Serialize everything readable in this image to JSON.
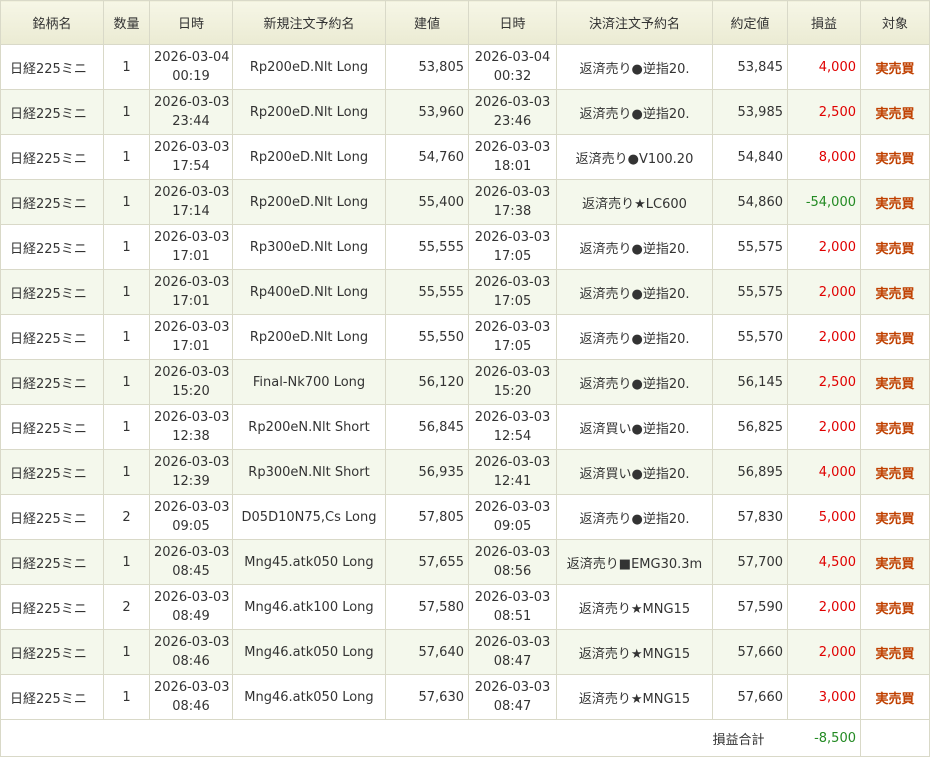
{
  "headers": [
    "銘柄名",
    "数量",
    "日時",
    "新規注文予約名",
    "建値",
    "日時",
    "決済注文予約名",
    "約定値",
    "損益",
    "対象"
  ],
  "rows": [
    {
      "symbol": "日経225ミニ",
      "qty": "1",
      "open_date": "2026-03-04",
      "open_time": "00:19",
      "entry_name": "Rp200eD.Nlt Long",
      "entry_price": "53,805",
      "close_date": "2026-03-04",
      "close_time": "00:32",
      "exit_name": "返済売り●逆指20.",
      "exit_price": "53,845",
      "pnl": "4,000",
      "pnl_sign": "pos",
      "target": "実売買"
    },
    {
      "symbol": "日経225ミニ",
      "qty": "1",
      "open_date": "2026-03-03",
      "open_time": "23:44",
      "entry_name": "Rp200eD.Nlt Long",
      "entry_price": "53,960",
      "close_date": "2026-03-03",
      "close_time": "23:46",
      "exit_name": "返済売り●逆指20.",
      "exit_price": "53,985",
      "pnl": "2,500",
      "pnl_sign": "pos",
      "target": "実売買"
    },
    {
      "symbol": "日経225ミニ",
      "qty": "1",
      "open_date": "2026-03-03",
      "open_time": "17:54",
      "entry_name": "Rp200eD.Nlt Long",
      "entry_price": "54,760",
      "close_date": "2026-03-03",
      "close_time": "18:01",
      "exit_name": "返済売り●V100.20",
      "exit_price": "54,840",
      "pnl": "8,000",
      "pnl_sign": "pos",
      "target": "実売買"
    },
    {
      "symbol": "日経225ミニ",
      "qty": "1",
      "open_date": "2026-03-03",
      "open_time": "17:14",
      "entry_name": "Rp200eD.Nlt Long",
      "entry_price": "55,400",
      "close_date": "2026-03-03",
      "close_time": "17:38",
      "exit_name": "返済売り★LC600",
      "exit_price": "54,860",
      "pnl": "-54,000",
      "pnl_sign": "neg",
      "target": "実売買"
    },
    {
      "symbol": "日経225ミニ",
      "qty": "1",
      "open_date": "2026-03-03",
      "open_time": "17:01",
      "entry_name": "Rp300eD.Nlt Long",
      "entry_price": "55,555",
      "close_date": "2026-03-03",
      "close_time": "17:05",
      "exit_name": "返済売り●逆指20.",
      "exit_price": "55,575",
      "pnl": "2,000",
      "pnl_sign": "pos",
      "target": "実売買"
    },
    {
      "symbol": "日経225ミニ",
      "qty": "1",
      "open_date": "2026-03-03",
      "open_time": "17:01",
      "entry_name": "Rp400eD.Nlt Long",
      "entry_price": "55,555",
      "close_date": "2026-03-03",
      "close_time": "17:05",
      "exit_name": "返済売り●逆指20.",
      "exit_price": "55,575",
      "pnl": "2,000",
      "pnl_sign": "pos",
      "target": "実売買"
    },
    {
      "symbol": "日経225ミニ",
      "qty": "1",
      "open_date": "2026-03-03",
      "open_time": "17:01",
      "entry_name": "Rp200eD.Nlt Long",
      "entry_price": "55,550",
      "close_date": "2026-03-03",
      "close_time": "17:05",
      "exit_name": "返済売り●逆指20.",
      "exit_price": "55,570",
      "pnl": "2,000",
      "pnl_sign": "pos",
      "target": "実売買"
    },
    {
      "symbol": "日経225ミニ",
      "qty": "1",
      "open_date": "2026-03-03",
      "open_time": "15:20",
      "entry_name": "Final-Nk700 Long",
      "entry_price": "56,120",
      "close_date": "2026-03-03",
      "close_time": "15:20",
      "exit_name": "返済売り●逆指20.",
      "exit_price": "56,145",
      "pnl": "2,500",
      "pnl_sign": "pos",
      "target": "実売買"
    },
    {
      "symbol": "日経225ミニ",
      "qty": "1",
      "open_date": "2026-03-03",
      "open_time": "12:38",
      "entry_name": "Rp200eN.Nlt Short",
      "entry_price": "56,845",
      "close_date": "2026-03-03",
      "close_time": "12:54",
      "exit_name": "返済買い●逆指20.",
      "exit_price": "56,825",
      "pnl": "2,000",
      "pnl_sign": "pos",
      "target": "実売買"
    },
    {
      "symbol": "日経225ミニ",
      "qty": "1",
      "open_date": "2026-03-03",
      "open_time": "12:39",
      "entry_name": "Rp300eN.Nlt Short",
      "entry_price": "56,935",
      "close_date": "2026-03-03",
      "close_time": "12:41",
      "exit_name": "返済買い●逆指20.",
      "exit_price": "56,895",
      "pnl": "4,000",
      "pnl_sign": "pos",
      "target": "実売買"
    },
    {
      "symbol": "日経225ミニ",
      "qty": "2",
      "open_date": "2026-03-03",
      "open_time": "09:05",
      "entry_name": "D05D10N75,Cs Long",
      "entry_price": "57,805",
      "close_date": "2026-03-03",
      "close_time": "09:05",
      "exit_name": "返済売り●逆指20.",
      "exit_price": "57,830",
      "pnl": "5,000",
      "pnl_sign": "pos",
      "target": "実売買"
    },
    {
      "symbol": "日経225ミニ",
      "qty": "1",
      "open_date": "2026-03-03",
      "open_time": "08:45",
      "entry_name": "Mng45.atk050 Long",
      "entry_price": "57,655",
      "close_date": "2026-03-03",
      "close_time": "08:56",
      "exit_name": "返済売り■EMG30.3m",
      "exit_price": "57,700",
      "pnl": "4,500",
      "pnl_sign": "pos",
      "target": "実売買"
    },
    {
      "symbol": "日経225ミニ",
      "qty": "2",
      "open_date": "2026-03-03",
      "open_time": "08:49",
      "entry_name": "Mng46.atk100 Long",
      "entry_price": "57,580",
      "close_date": "2026-03-03",
      "close_time": "08:51",
      "exit_name": "返済売り★MNG15",
      "exit_price": "57,590",
      "pnl": "2,000",
      "pnl_sign": "pos",
      "target": "実売買"
    },
    {
      "symbol": "日経225ミニ",
      "qty": "1",
      "open_date": "2026-03-03",
      "open_time": "08:46",
      "entry_name": "Mng46.atk050 Long",
      "entry_price": "57,640",
      "close_date": "2026-03-03",
      "close_time": "08:47",
      "exit_name": "返済売り★MNG15",
      "exit_price": "57,660",
      "pnl": "2,000",
      "pnl_sign": "pos",
      "target": "実売買"
    },
    {
      "symbol": "日経225ミニ",
      "qty": "1",
      "open_date": "2026-03-03",
      "open_time": "08:46",
      "entry_name": "Mng46.atk050 Long",
      "entry_price": "57,630",
      "close_date": "2026-03-03",
      "close_time": "08:47",
      "exit_name": "返済売り★MNG15",
      "exit_price": "57,660",
      "pnl": "3,000",
      "pnl_sign": "pos",
      "target": "実売買"
    }
  ],
  "total": {
    "label": "損益合計",
    "value": "-8,500",
    "sign": "neg"
  },
  "colors": {
    "positive": "#e00000",
    "negative": "#238a23",
    "target": "#c04000",
    "header_bg": "#f0f0dc",
    "alt_row_bg": "#f4f8ec",
    "border": "#d9d9c8"
  }
}
